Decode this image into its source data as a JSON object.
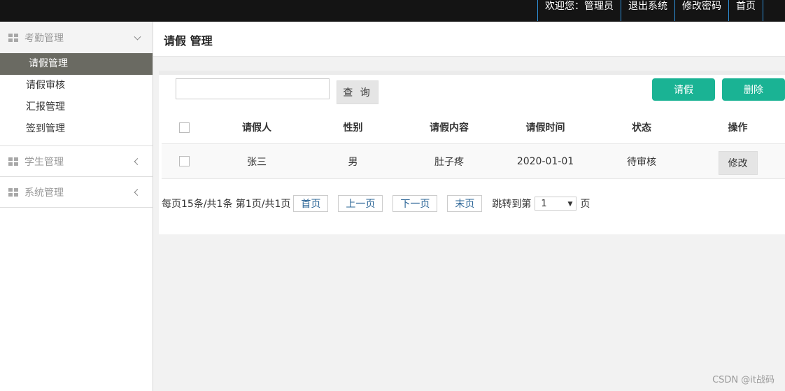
{
  "topnav": {
    "welcome": "欢迎您：管理员",
    "logout": "退出系统",
    "change_password": "修改密码",
    "home": "首页"
  },
  "sidebar": {
    "groups": [
      {
        "label": "考勤管理",
        "expanded": true,
        "items": [
          {
            "label": "请假管理",
            "active": true
          },
          {
            "label": "请假审核",
            "active": false
          },
          {
            "label": "汇报管理",
            "active": false
          },
          {
            "label": "签到管理",
            "active": false
          }
        ]
      },
      {
        "label": "学生管理",
        "expanded": false
      },
      {
        "label": "系统管理",
        "expanded": false
      }
    ]
  },
  "header": {
    "title": "请假 管理"
  },
  "toolbar": {
    "search_value": "",
    "search_label": "查 询",
    "leave_label": "请假",
    "delete_label": "删除",
    "accent_color": "#1ab394"
  },
  "table": {
    "columns": [
      "请假人",
      "性别",
      "请假内容",
      "请假时间",
      "状态",
      "操作"
    ],
    "rows": [
      {
        "name": "张三",
        "gender": "男",
        "content": "肚子疼",
        "date": "2020-01-01",
        "status": "待审核",
        "action": "修改"
      }
    ]
  },
  "pager": {
    "summary": "每页15条/共1条 第1页/共1页",
    "first": "首页",
    "prev": "上一页",
    "next": "下一页",
    "last": "末页",
    "jump_prefix": "跳转到第",
    "page_value": "1",
    "jump_suffix": "页"
  },
  "watermark": "CSDN @it战码"
}
